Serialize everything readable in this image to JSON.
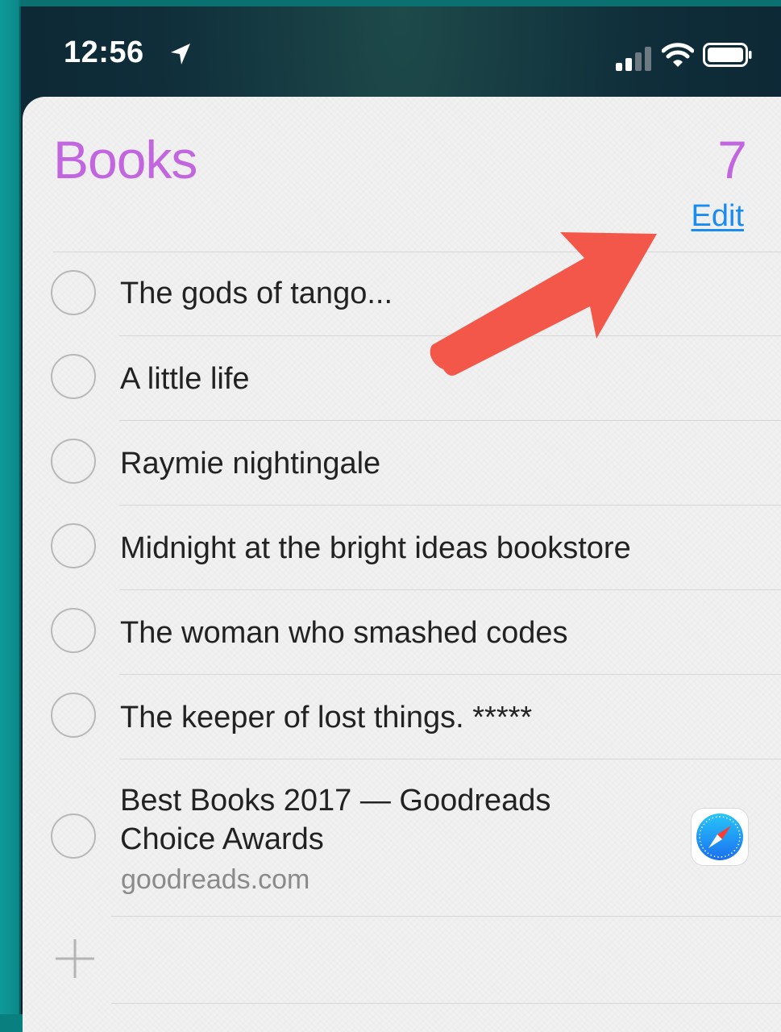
{
  "status_bar": {
    "time": "12:56",
    "location_icon": "location-arrow-icon",
    "signal_icon": "cellular-signal-icon",
    "wifi_icon": "wifi-icon",
    "battery_icon": "battery-icon"
  },
  "list": {
    "title": "Books",
    "count": "7",
    "edit_label": "Edit",
    "accent_color": "#c266e0",
    "link_color": "#1a8cf0"
  },
  "items": [
    {
      "title": "The gods of tango..."
    },
    {
      "title": "A little life"
    },
    {
      "title": "Raymie nightingale"
    },
    {
      "title": "Midnight at the bright ideas bookstore"
    },
    {
      "title": "The woman who smashed codes"
    },
    {
      "title": "The keeper of lost things. *****"
    },
    {
      "title_line1": "Best Books 2017 — Goodreads",
      "title_line2": "Choice Awards",
      "subtitle": "goodreads.com",
      "attachment_icon": "safari-icon"
    }
  ],
  "add_icon": "plus-icon",
  "annotation": {
    "icon": "red-arrow-icon",
    "color": "#f2574a"
  }
}
